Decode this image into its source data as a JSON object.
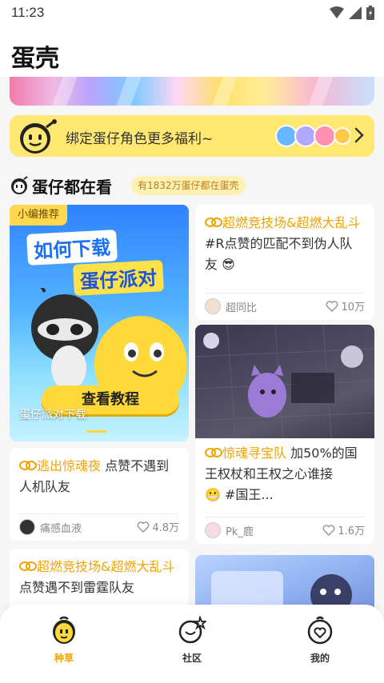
{
  "status_bar": {
    "time": "11:23"
  },
  "header": {
    "title": "蛋壳"
  },
  "bind_card": {
    "text": "绑定蛋仔角色更多福利~"
  },
  "section": {
    "title": "蛋仔都在看",
    "badge": "有1832万蛋仔都在蛋壳"
  },
  "feature_card": {
    "tag": "小编推荐",
    "headline_line1": "如何下载",
    "headline_line2": "蛋仔派对",
    "button_label": "查看教程",
    "caption": "蛋仔派对下载"
  },
  "posts": [
    {
      "topic": "超燃竞技场&超燃大乱斗",
      "text": " #R点赞的匹配不到伪人队友",
      "author": "超同比",
      "likes": "10万"
    },
    {
      "topic": "惊魂寻宝队",
      "text": " 加50%的国王权杖和王权之心谁接",
      "text2": " #国王...",
      "author": "Pk_鹿",
      "likes": "1.6万"
    },
    {
      "topic": "逃出惊魂夜",
      "text": " 点赞不遇到人机队友",
      "author": "痛感血液",
      "likes": "4.8万"
    },
    {
      "topic": "超燃竞技场&超燃大乱斗",
      "text": " 点赞遇不到雷霆队友"
    }
  ],
  "bottom_nav": [
    {
      "label": "种草",
      "icon": "egg-mascot-icon",
      "active": true
    },
    {
      "label": "社区",
      "icon": "planet-star-icon",
      "active": false
    },
    {
      "label": "我的",
      "icon": "profile-heart-icon",
      "active": false
    }
  ],
  "colors": {
    "accent": "#f2a300",
    "bind_card_bg": "#ffe871",
    "active_nav": "#f2a300"
  }
}
